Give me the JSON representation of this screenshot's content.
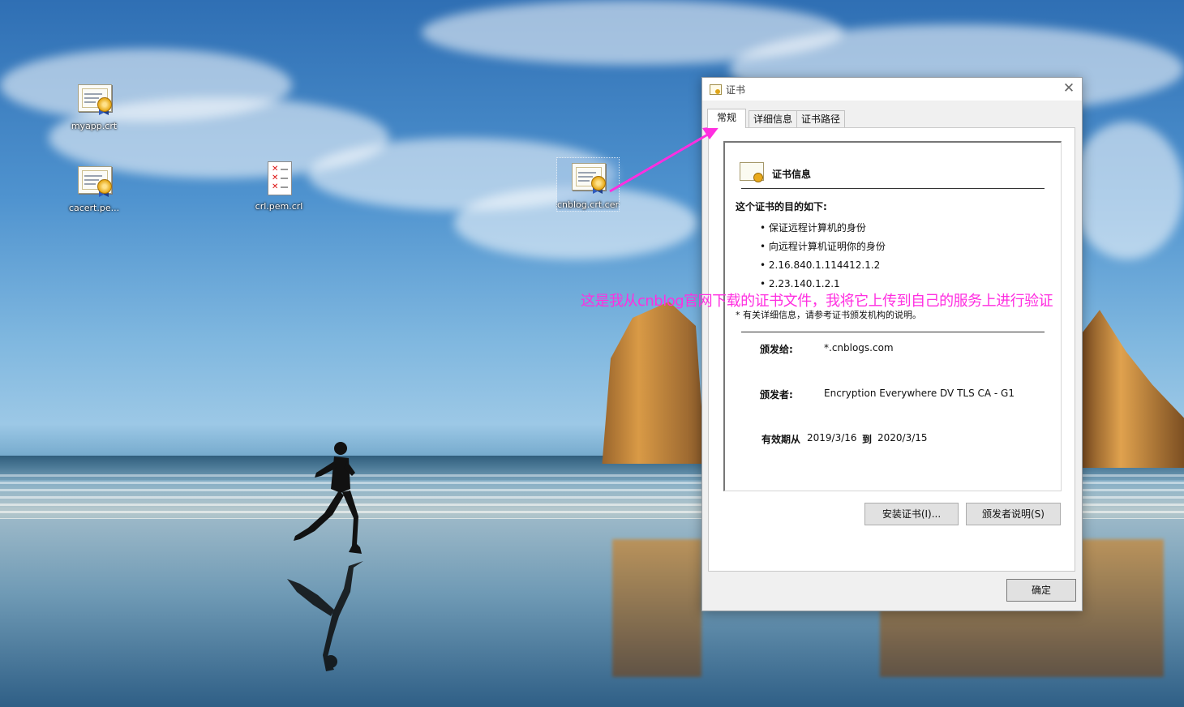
{
  "desktop": {
    "icons": [
      {
        "label": "myapp.crt",
        "type": "certificate"
      },
      {
        "label": "cacert.pe...",
        "type": "certificate"
      },
      {
        "label": "crl.pem.crl",
        "type": "crl"
      },
      {
        "label": "cnblog.crt.cer",
        "type": "certificate",
        "selected": true
      }
    ],
    "annotation": "这是我从cnblog官网下载的证书文件，我将它上传到自己的服务上进行验证",
    "annotation_color": "#ff2ee0"
  },
  "dialog": {
    "title": "证书",
    "tabs": [
      {
        "label": "常规",
        "active": true
      },
      {
        "label": "详细信息",
        "active": false
      },
      {
        "label": "证书路径",
        "active": false
      }
    ],
    "info_title": "证书信息",
    "purpose_heading": "这个证书的目的如下:",
    "purposes": [
      "保证远程计算机的身份",
      "向远程计算机证明你的身份",
      "2.16.840.1.114412.1.2",
      "2.23.140.1.2.1"
    ],
    "note": "* 有关详细信息，请参考证书颁发机构的说明。",
    "issued_to_label": "颁发给:",
    "issued_to": "*.cnblogs.com",
    "issued_by_label": "颁发者:",
    "issued_by": "Encryption Everywhere DV TLS CA - G1",
    "valid_from_label": "有效期从",
    "valid_from": "2019/3/16",
    "valid_to_label": "到",
    "valid_to": "2020/3/15",
    "install_button": "安装证书(I)...",
    "issuer_statement_button": "颁发者说明(S)",
    "ok_button": "确定"
  }
}
